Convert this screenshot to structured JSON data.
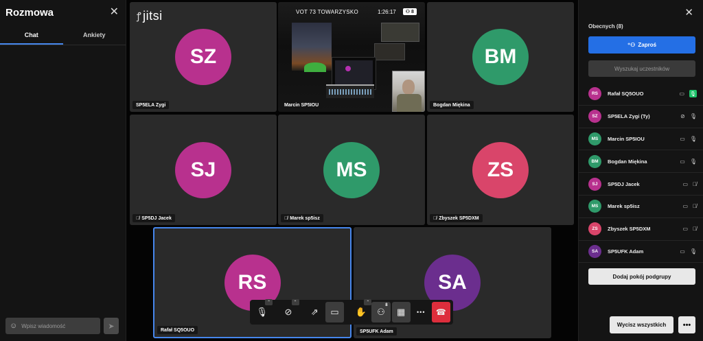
{
  "colors": {
    "accent": "#246fe5",
    "magenta": "#b8318e",
    "green": "#2f9a6a",
    "pink": "#d9456a",
    "purple": "#6b2e8e",
    "hangup": "#dd2e3c"
  },
  "chat": {
    "title": "Rozmowa",
    "close_icon": "close-icon",
    "tabs": [
      {
        "label": "Chat",
        "active": true
      },
      {
        "label": "Ankiety",
        "active": false
      }
    ],
    "input_placeholder": "Wpisz wiadomość",
    "emoji_icon": "emoji-icon",
    "send_icon": "send-icon"
  },
  "header": {
    "logo": "jitsi",
    "subject": "VOT 73 TOWARZYSKO",
    "time": "1:26:17",
    "participant_count": "8"
  },
  "tiles": [
    {
      "initials": "SZ",
      "name": "SP5ELA Zygi",
      "color": "#b8318e",
      "muted": false
    },
    {
      "initials": "",
      "name": "Marcin SP5IOU",
      "color": "",
      "muted": false,
      "video": true
    },
    {
      "initials": "BM",
      "name": "Bogdan Miękina",
      "color": "#2f9a6a",
      "muted": false
    },
    {
      "initials": "SJ",
      "name": "SP5DJ Jacek",
      "color": "#b8318e",
      "muted": true
    },
    {
      "initials": "MS",
      "name": "Marek sp5isz",
      "color": "#2f9a6a",
      "muted": true
    },
    {
      "initials": "ZS",
      "name": "Zbyszek SP5DXM",
      "color": "#d9456a",
      "muted": true
    },
    {
      "initials": "RS",
      "name": "Rafał SQ5OUO",
      "color": "#b8318e",
      "muted": false,
      "active": true
    },
    {
      "initials": "SA",
      "name": "SP5UFK Adam",
      "color": "#6b2e8e",
      "muted": false
    }
  ],
  "toolbar": {
    "buttons": [
      {
        "name": "microphone-icon",
        "glyph": "🎙"
      },
      {
        "name": "camera-off-icon",
        "glyph": "⊘"
      },
      {
        "name": "screen-share-icon",
        "glyph": "⇗"
      },
      {
        "name": "chat-icon",
        "glyph": "💬"
      },
      {
        "name": "raise-hand-icon",
        "glyph": "✋"
      },
      {
        "name": "participants-icon",
        "glyph": "👥"
      },
      {
        "name": "tile-view-icon",
        "glyph": "▦"
      },
      {
        "name": "more-icon",
        "glyph": "•••"
      },
      {
        "name": "hangup-icon",
        "glyph": "☎"
      }
    ],
    "participants_badge": "8"
  },
  "participants": {
    "title": "Obecnych (8)",
    "invite_label": "Zaproś",
    "search_placeholder": "Wyszukaj uczestników",
    "list": [
      {
        "initials": "RS",
        "name": "Rafał SQ5OUO",
        "color": "#b8318e",
        "mic": "active"
      },
      {
        "initials": "SZ",
        "name": "SP5ELA Zygi (Ty)",
        "color": "#b8318e",
        "mic": "on"
      },
      {
        "initials": "MS",
        "name": "Marcin SP5IOU",
        "color": "#2f9a6a",
        "mic": "on"
      },
      {
        "initials": "BM",
        "name": "Bogdan Miękina",
        "color": "#2f9a6a",
        "mic": "on"
      },
      {
        "initials": "SJ",
        "name": "SP5DJ Jacek",
        "color": "#b8318e",
        "mic": "muted"
      },
      {
        "initials": "MS",
        "name": "Marek sp5isz",
        "color": "#2f9a6a",
        "mic": "muted"
      },
      {
        "initials": "ZS",
        "name": "Zbyszek SP5DXM",
        "color": "#d9456a",
        "mic": "muted"
      },
      {
        "initials": "SA",
        "name": "SP5UFK Adam",
        "color": "#6b2e8e",
        "mic": "on"
      }
    ],
    "breakout_label": "Dodaj pokój podgrupy",
    "mute_all_label": "Wycisz wszystkich",
    "more_label": "•••"
  }
}
